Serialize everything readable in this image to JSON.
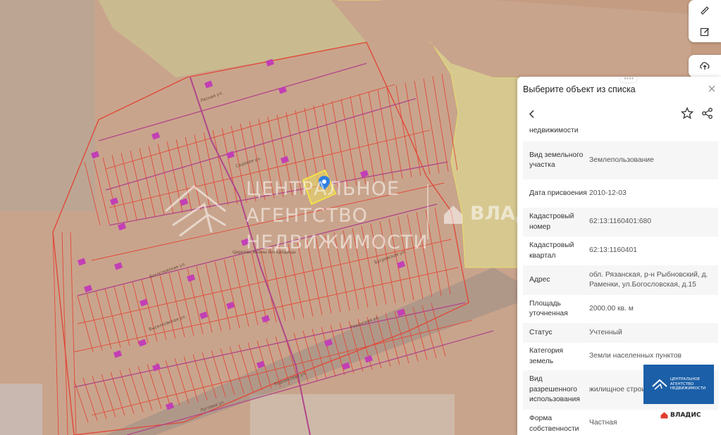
{
  "map": {
    "watermark_lines": [
      "ЦЕНТРАЛЬНОЕ",
      "АГЕНТСТВО",
      "НЕДВИЖИМОСТИ"
    ],
    "watermark2": "ВЛАД",
    "street_labels": [
      "Лесная ул.",
      "Садовая ул.",
      "Богословская ул.",
      "Бугровская ул.",
      "Выселковская ул.",
      "Луговая ул.",
      "Рязанская ул.",
      "Родниковая ул.",
      "Церковь Иконы Богородицы"
    ]
  },
  "tools": {
    "ruler": "ruler-icon",
    "edit": "edit-icon",
    "upload": "upload-icon"
  },
  "panel": {
    "title": "Выберите объект из списка",
    "rows": [
      {
        "key": "недвижимости",
        "value": ""
      },
      {
        "key": "Вид земельного участка",
        "value": "Землепользование"
      },
      {
        "key": "Дата присвоения",
        "value": "2010-12-03"
      },
      {
        "key": "Кадастровый номер",
        "value": "62:13:1160401:680"
      },
      {
        "key": "Кадастровый квартал",
        "value": "62:13:1160401"
      },
      {
        "key": "Адрес",
        "value": "обл. Рязанская, р-н Рыбновский, д. Раменки, ул.Богословская, д.15"
      },
      {
        "key": "Площадь уточненная",
        "value": "2000.00 кв. м"
      },
      {
        "key": "Статус",
        "value": "Учтенный"
      },
      {
        "key": "Категория земель",
        "value": "Земли населенных пунктов"
      },
      {
        "key": "Вид разрешенного использования",
        "value": "жилищное строи"
      },
      {
        "key": "Форма собственности",
        "value": "Частная"
      }
    ]
  },
  "logo": {
    "lines": [
      "ЦЕНТРАЛЬНОЕ",
      "АГЕНТСТВО",
      "НЕДВИЖИМОСТИ"
    ],
    "brand": "ВЛАДИС"
  },
  "colors": {
    "zone": "#c9a48c",
    "yellow_zone": "#d7c890",
    "plot_lines": "#e04a3a",
    "road": "#b0478a",
    "selected": "#f2e24a",
    "accent": "#1b5fa8"
  }
}
